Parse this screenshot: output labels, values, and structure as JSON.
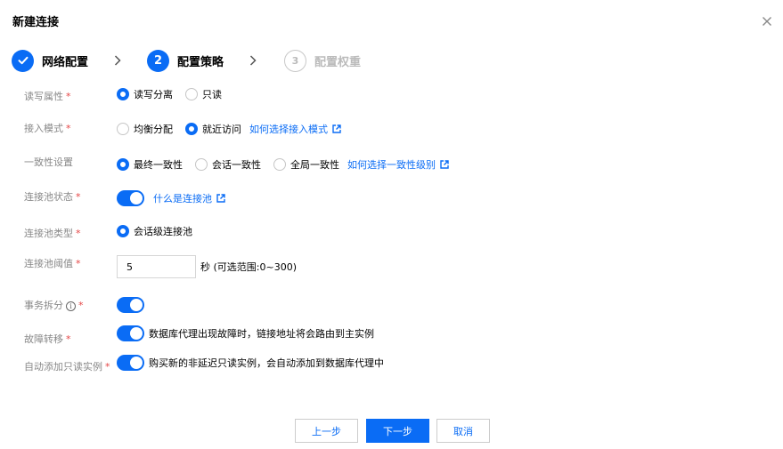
{
  "dialog": {
    "title": "新建连接"
  },
  "steps": [
    {
      "number": "1",
      "label": "网络配置",
      "state": "done"
    },
    {
      "number": "2",
      "label": "配置策略",
      "state": "active"
    },
    {
      "number": "3",
      "label": "配置权重",
      "state": "todo"
    }
  ],
  "form": {
    "rw_attr": {
      "label": "读写属性",
      "options": [
        "读写分离",
        "只读"
      ],
      "selected": "读写分离"
    },
    "access_mode": {
      "label": "接入模式",
      "options": [
        "均衡分配",
        "就近访问"
      ],
      "selected": "就近访问",
      "help_link": "如何选择接入模式"
    },
    "consistency": {
      "label": "一致性设置",
      "options": [
        "最终一致性",
        "会话一致性",
        "全局一致性"
      ],
      "selected": "最终一致性",
      "help_link": "如何选择一致性级别"
    },
    "pool_status": {
      "label": "连接池状态",
      "enabled": true,
      "help_link": "什么是连接池"
    },
    "pool_type": {
      "label": "连接池类型",
      "options": [
        "会话级连接池"
      ],
      "selected": "会话级连接池"
    },
    "pool_threshold": {
      "label": "连接池阈值",
      "value": "5",
      "unit_hint": "秒 (可选范围:0~300)"
    },
    "txn_split": {
      "label": "事务拆分",
      "enabled": true
    },
    "failover": {
      "label": "故障转移",
      "enabled": true,
      "description": "数据库代理出现故障时，链接地址将会路由到主实例"
    },
    "auto_add_ro": {
      "label": "自动添加只读实例",
      "enabled": true,
      "description": "购买新的非延迟只读实例，会自动添加到数据库代理中"
    }
  },
  "required_mark": "*",
  "buttons": {
    "prev": "上一步",
    "next": "下一步",
    "cancel": "取消"
  },
  "colors": {
    "accent": "#0a6cf5",
    "required": "#e54545",
    "label": "#888888",
    "disabled": "#bbbbbb"
  }
}
